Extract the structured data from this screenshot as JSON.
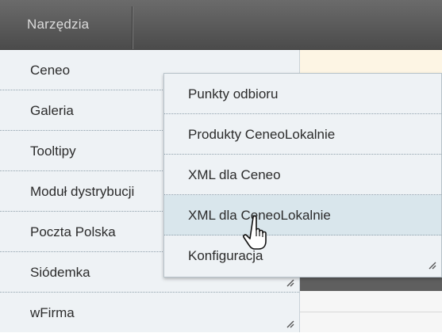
{
  "topbar": {
    "menu_label": "Narzędzia"
  },
  "submenu": {
    "items": [
      {
        "label": "Ceneo"
      },
      {
        "label": "Galeria"
      },
      {
        "label": "Tooltipy"
      },
      {
        "label": "Moduł dystrybucji"
      },
      {
        "label": "Poczta Polska"
      },
      {
        "label": "Siódemka"
      },
      {
        "label": "wFirma"
      }
    ]
  },
  "popup": {
    "items": [
      {
        "label": "Punkty odbioru"
      },
      {
        "label": "Produkty CeneoLokalnie"
      },
      {
        "label": "XML dla Ceneo"
      },
      {
        "label": "XML dla CeneoLokalnie",
        "hovered": true
      },
      {
        "label": "Konfiguracja"
      }
    ]
  },
  "colors": {
    "topbar": "#555555",
    "menu_bg": "#eef2f5",
    "hover_bg": "#d9e6ec",
    "separator": "#8fa0ab"
  },
  "icons": {
    "resize_grip": "resize-grip-icon",
    "cursor": "hand-pointer-icon"
  }
}
